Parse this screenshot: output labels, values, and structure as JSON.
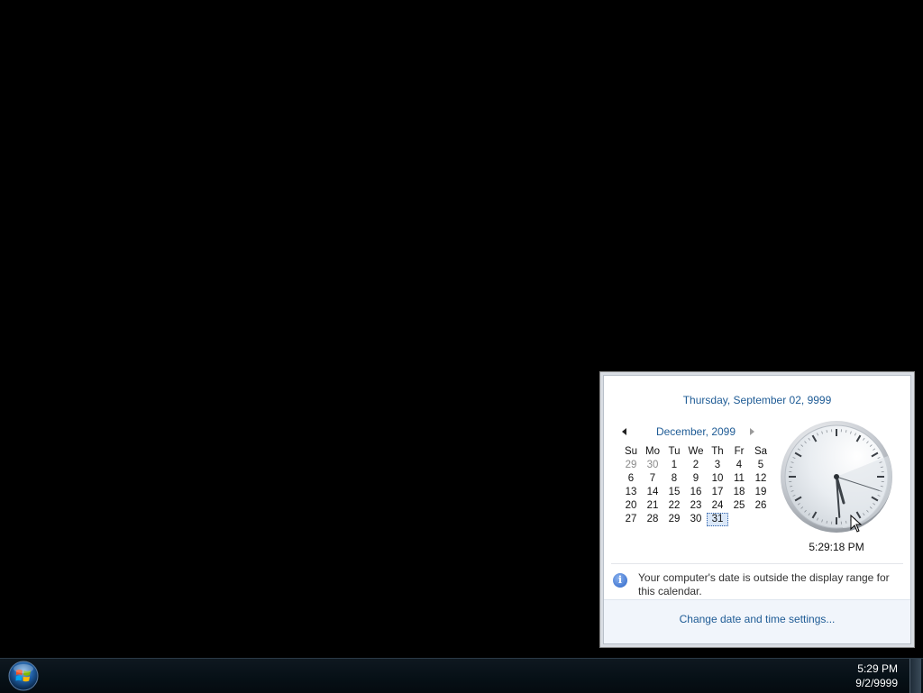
{
  "flyout": {
    "date_header": "Thursday, September 02, 9999",
    "calendar": {
      "month_title": "December, 2099",
      "weekdays": [
        "Su",
        "Mo",
        "Tu",
        "We",
        "Th",
        "Fr",
        "Sa"
      ],
      "days": [
        {
          "d": "29",
          "other": true
        },
        {
          "d": "30",
          "other": true
        },
        {
          "d": "1"
        },
        {
          "d": "2"
        },
        {
          "d": "3"
        },
        {
          "d": "4"
        },
        {
          "d": "5"
        },
        {
          "d": "6"
        },
        {
          "d": "7"
        },
        {
          "d": "8"
        },
        {
          "d": "9"
        },
        {
          "d": "10"
        },
        {
          "d": "11"
        },
        {
          "d": "12"
        },
        {
          "d": "13"
        },
        {
          "d": "14"
        },
        {
          "d": "15"
        },
        {
          "d": "16"
        },
        {
          "d": "17"
        },
        {
          "d": "18"
        },
        {
          "d": "19"
        },
        {
          "d": "20"
        },
        {
          "d": "21"
        },
        {
          "d": "22"
        },
        {
          "d": "23"
        },
        {
          "d": "24"
        },
        {
          "d": "25"
        },
        {
          "d": "26"
        },
        {
          "d": "27"
        },
        {
          "d": "28"
        },
        {
          "d": "29"
        },
        {
          "d": "30"
        },
        {
          "d": "31",
          "selected": true
        }
      ]
    },
    "clock": {
      "time_text": "5:29:18 PM",
      "hour": 5,
      "minute": 29,
      "second": 18
    },
    "info_text": "Your computer's date is outside the display range for this calendar.",
    "footer_link": "Change date and time settings..."
  },
  "taskbar": {
    "time": "5:29 PM",
    "date": "9/2/9999"
  },
  "colors": {
    "link": "#1e5b95",
    "background": "#000000"
  }
}
